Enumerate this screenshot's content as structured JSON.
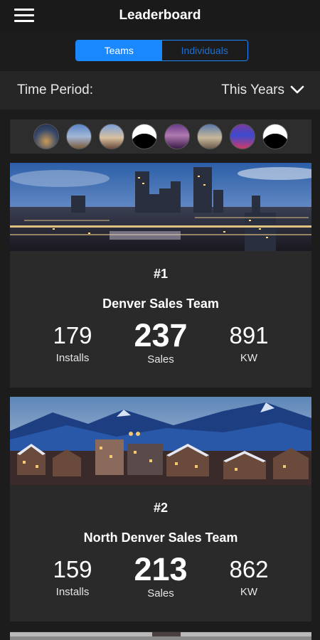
{
  "header": {
    "title": "Leaderboard",
    "menu_icon": "hamburger-menu-icon"
  },
  "tabs": {
    "teams": "Teams",
    "individuals": "Individuals",
    "active": "teams"
  },
  "filter": {
    "label": "Time Period:",
    "value": "This Years"
  },
  "avatars": [
    "team-avatar-1",
    "team-avatar-2",
    "team-avatar-3",
    "team-avatar-4",
    "team-avatar-5",
    "team-avatar-6",
    "team-avatar-7",
    "team-avatar-8"
  ],
  "teams": [
    {
      "rank": "#1",
      "name": "Denver Sales Team",
      "installs": "179",
      "sales": "237",
      "kw": "891",
      "installs_label": "Installs",
      "sales_label": "Sales",
      "kw_label": "KW"
    },
    {
      "rank": "#2",
      "name": "North Denver Sales Team",
      "installs": "159",
      "sales": "213",
      "kw": "862",
      "installs_label": "Installs",
      "sales_label": "Sales",
      "kw_label": "KW"
    }
  ],
  "colors": {
    "accent": "#1a88ff",
    "background": "#1c1c1c",
    "card": "#2a2a2a"
  }
}
